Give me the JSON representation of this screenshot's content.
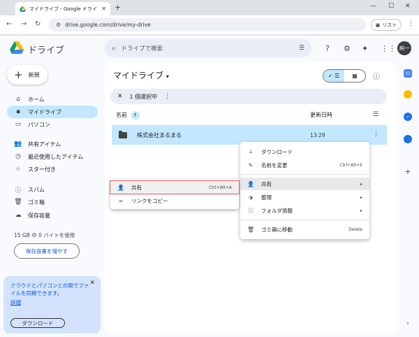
{
  "browser": {
    "tab_title": "マイドライブ - Google ドライブ",
    "url": "drive.google.com/drive/my-drive",
    "list_label": "リスト"
  },
  "header": {
    "brand": "ドライブ",
    "search_placeholder": "ドライブで検索",
    "avatar_label": "純一"
  },
  "sidebar": {
    "new_label": "新規",
    "items": [
      {
        "label": "ホーム",
        "icon": "home-icon"
      },
      {
        "label": "マイドライブ",
        "icon": "my-drive-icon"
      },
      {
        "label": "パソコン",
        "icon": "computer-icon"
      },
      {
        "label": "共有アイテム",
        "icon": "shared-icon"
      },
      {
        "label": "最近使用したアイテム",
        "icon": "clock-icon"
      },
      {
        "label": "スター付き",
        "icon": "star-icon"
      },
      {
        "label": "スパム",
        "icon": "spam-icon"
      },
      {
        "label": "ゴミ箱",
        "icon": "trash-icon"
      },
      {
        "label": "保存容量",
        "icon": "cloud-icon"
      }
    ],
    "storage_text": "15 GB 中 0 バイトを使用",
    "storage_button": "保存容量を増やす"
  },
  "promo": {
    "text": "クラウドとパソコンとの間でファイルを同期できます。",
    "link": "詳細",
    "button": "ダウンロード"
  },
  "main": {
    "title": "マイドライブ",
    "selection_text": "1 個選択中",
    "col_name": "名前",
    "col_modified": "更新日時",
    "file": {
      "name": "株式会社まるまる",
      "time": "13:29"
    }
  },
  "context_menu": {
    "items": [
      {
        "label": "ダウンロード",
        "icon": "download-icon",
        "shortcut": ""
      },
      {
        "label": "名前を変更",
        "icon": "rename-icon",
        "shortcut": "Ctrl+Alt+E"
      },
      {
        "label": "共有",
        "icon": "share-icon",
        "shortcut": ""
      },
      {
        "label": "整理",
        "icon": "organize-icon",
        "shortcut": ""
      },
      {
        "label": "フォルダ情報",
        "icon": "info-icon",
        "shortcut": ""
      },
      {
        "label": "ゴミ箱に移動",
        "icon": "trash-icon",
        "shortcut": "Delete"
      }
    ]
  },
  "submenu": {
    "items": [
      {
        "label": "共有",
        "shortcut": "Ctrl+Alt+A"
      },
      {
        "label": "リンクをコピー",
        "shortcut": ""
      }
    ]
  },
  "colors": {
    "accent": "#0b57d0",
    "selection": "#c2e7ff",
    "highlight_border": "#e05a5a"
  }
}
